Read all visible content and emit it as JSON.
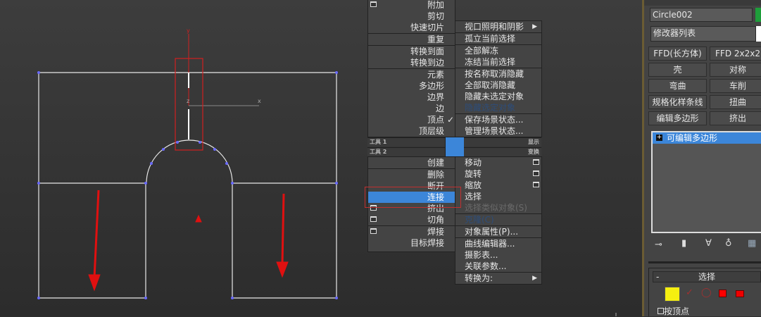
{
  "viewport": {
    "axis_y": "y",
    "axis_x": "x",
    "axis_z": "z"
  },
  "quad_left": {
    "items": [
      {
        "label": "附加",
        "box": true
      },
      {
        "label": "剪切"
      },
      {
        "label": "快速切片",
        "sep_after": true
      },
      {
        "label": "重复",
        "sep_after": true
      },
      {
        "label": "转换到面"
      },
      {
        "label": "转换到边",
        "sep_after": true
      },
      {
        "label": "元素"
      },
      {
        "label": "多边形"
      },
      {
        "label": "边界"
      },
      {
        "label": "边"
      },
      {
        "label": "顶点",
        "checked": true
      },
      {
        "label": "顶层级"
      }
    ],
    "items2": [
      {
        "label": "创建",
        "sep_after": true
      },
      {
        "label": "删除"
      },
      {
        "label": "断开"
      },
      {
        "label": "连接",
        "highlighted": true
      },
      {
        "label": "挤出",
        "box": true
      },
      {
        "label": "切角",
        "box": true,
        "sep_after": true
      },
      {
        "label": "焊接",
        "box": true
      },
      {
        "label": "目标焊接"
      }
    ]
  },
  "quad_right": {
    "items": [
      {
        "label": "视口照明和阴影",
        "submenu": true,
        "sep_after": true
      },
      {
        "label": "孤立当前选择",
        "sep_after": true
      },
      {
        "label": "全部解冻"
      },
      {
        "label": "冻结当前选择",
        "sep_after": true
      },
      {
        "label": "按名称取消隐藏"
      },
      {
        "label": "全部取消隐藏"
      },
      {
        "label": "隐藏未选定对象"
      },
      {
        "label": "隐藏选定对象",
        "style": "blue",
        "sep_after": true
      },
      {
        "label": "保存场景状态..."
      },
      {
        "label": "管理场景状态..."
      }
    ],
    "items2": [
      {
        "label": "移动",
        "box": true
      },
      {
        "label": "旋转",
        "box": true
      },
      {
        "label": "缩放",
        "box": true
      },
      {
        "label": "选择"
      },
      {
        "label": "选择类似对象(S)",
        "style": "dis",
        "sep_after": true
      },
      {
        "label": "克隆(C)",
        "style": "blue",
        "sep_after": true
      },
      {
        "label": "对象属性(P)...",
        "sep_after": true
      },
      {
        "label": "曲线编辑器..."
      },
      {
        "label": "摄影表..."
      },
      {
        "label": "关联参数...",
        "sep_after": true
      },
      {
        "label": "转换为:",
        "submenu": true
      }
    ]
  },
  "toolbars": {
    "tools1": "工具 1",
    "tools2": "工具 2",
    "display": "显示",
    "transform": "变换"
  },
  "panel": {
    "object_name": "Circle002",
    "object_color": "#1e9e3a",
    "modifier_list": "修改器列表",
    "buttons": [
      "FFD(长方体)",
      "FFD 2x2x2",
      "壳",
      "对称",
      "弯曲",
      "车削",
      "规格化样条线",
      "扭曲",
      "编辑多边形",
      "挤出"
    ],
    "stack_item": "可编辑多边形",
    "rollout_title": "选择",
    "by_vertex": "按顶点"
  },
  "colors": {
    "highlight": "#3c86d9",
    "annotation": "#e01010"
  }
}
